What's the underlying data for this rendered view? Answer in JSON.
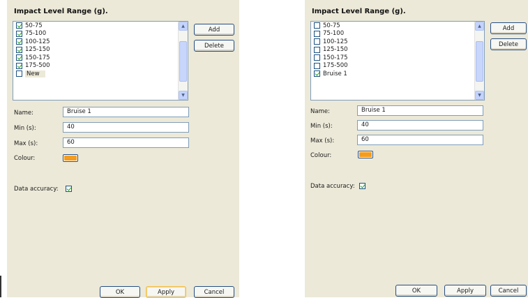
{
  "left_dialog": {
    "title": "Impact Level Range (g).",
    "ranges": [
      {
        "label": "50-75",
        "checked": true
      },
      {
        "label": "75-100",
        "checked": true
      },
      {
        "label": "100-125",
        "checked": true
      },
      {
        "label": "125-150",
        "checked": true
      },
      {
        "label": "150-175",
        "checked": true
      },
      {
        "label": "175-500",
        "checked": true
      },
      {
        "label": "New",
        "checked": false
      }
    ],
    "add_label": "Add",
    "delete_label": "Delete",
    "name_label": "Name:",
    "name_value": "Bruise 1",
    "min_label": "Min (s):",
    "min_value": "40",
    "max_label": "Max (s):",
    "max_value": "60",
    "colour_label": "Colour:",
    "colour": "#f39c1f",
    "accuracy_label": "Data accuracy:",
    "accuracy_checked": true,
    "ok_label": "OK",
    "apply_label": "Apply",
    "cancel_label": "Cancel"
  },
  "right_dialog": {
    "title": "Impact Level Range (g).",
    "ranges": [
      {
        "label": "50-75",
        "checked": false
      },
      {
        "label": "75-100",
        "checked": false
      },
      {
        "label": "100-125",
        "checked": false
      },
      {
        "label": "125-150",
        "checked": false
      },
      {
        "label": "150-175",
        "checked": false
      },
      {
        "label": "175-500",
        "checked": false
      },
      {
        "label": "Bruise 1",
        "checked": true
      }
    ],
    "add_label": "Add",
    "delete_label": "Delete",
    "name_label": "Name:",
    "name_value": "Bruise 1",
    "min_label": "Min (s):",
    "min_value": "40",
    "max_label": "Max (s):",
    "max_value": "60",
    "colour_label": "Colour:",
    "colour": "#f39c1f",
    "accuracy_label": "Data accuracy:",
    "accuracy_checked": true,
    "ok_label": "OK",
    "apply_label": "Apply",
    "cancel_label": "Cancel"
  }
}
